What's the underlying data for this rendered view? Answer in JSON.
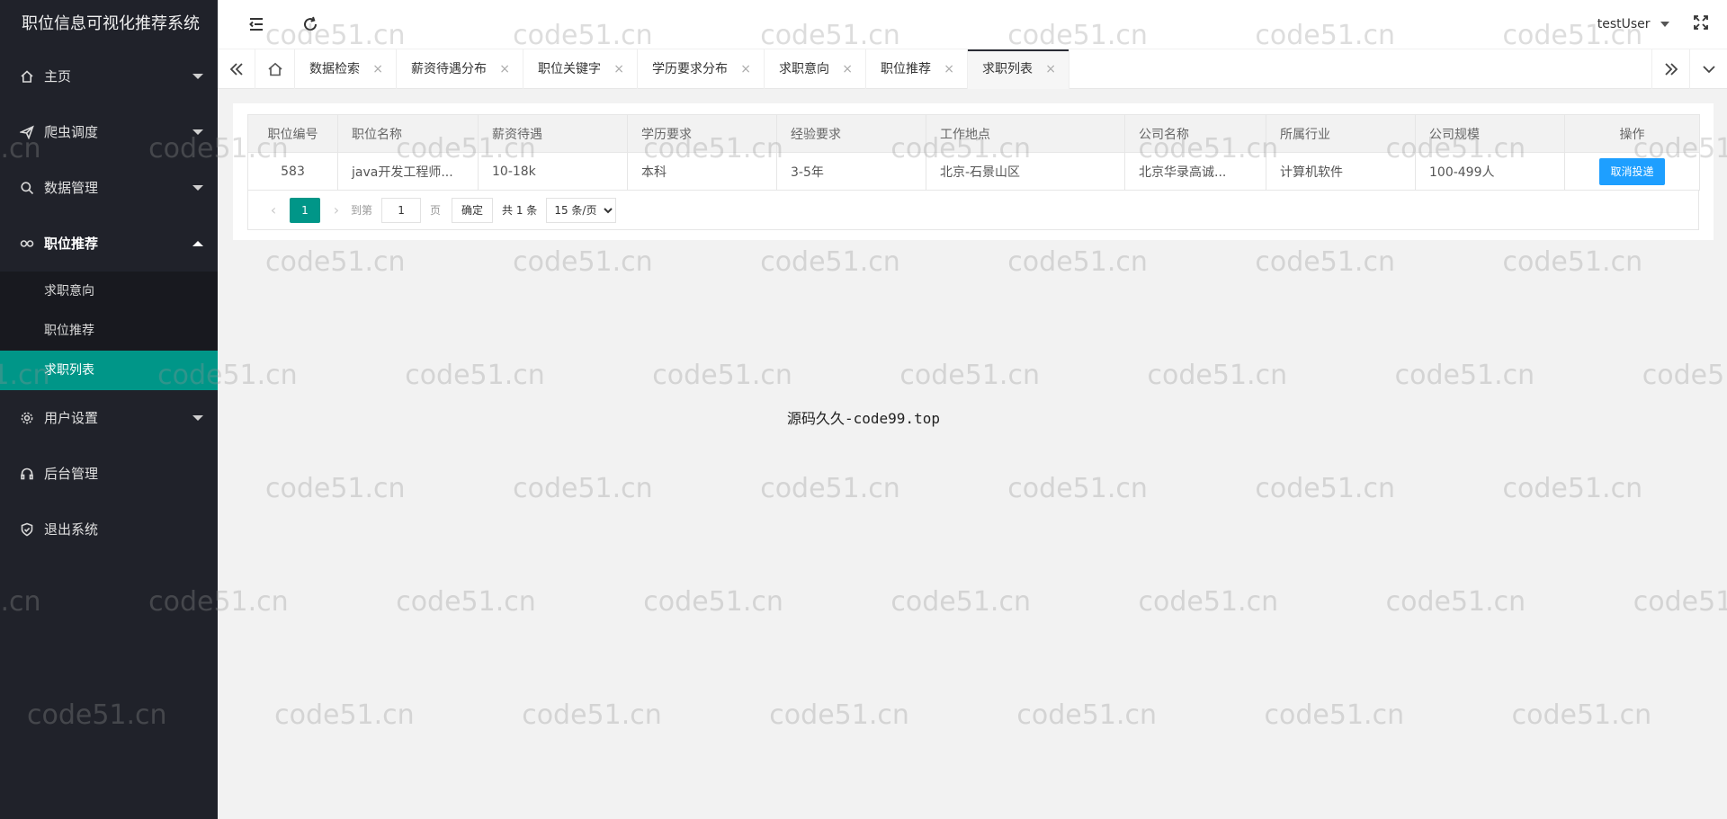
{
  "app": {
    "title": "职位信息可视化推荐系统"
  },
  "sidebar": {
    "items": [
      {
        "label": "主页",
        "icon": "home-icon",
        "hasSub": true
      },
      {
        "label": "爬虫调度",
        "icon": "send-icon",
        "hasSub": true
      },
      {
        "label": "数据管理",
        "icon": "search-icon",
        "hasSub": true
      },
      {
        "label": "职位推荐",
        "icon": "link-icon",
        "hasSub": true,
        "open": true
      },
      {
        "label": "用户设置",
        "icon": "gear-icon",
        "hasSub": true
      },
      {
        "label": "后台管理",
        "icon": "headset-icon",
        "hasSub": false
      },
      {
        "label": "退出系统",
        "icon": "shield-icon",
        "hasSub": false
      }
    ],
    "submenu": [
      {
        "label": "求职意向"
      },
      {
        "label": "职位推荐"
      },
      {
        "label": "求职列表",
        "active": true
      }
    ]
  },
  "header": {
    "user": "testUser"
  },
  "tabs": [
    {
      "label": "数据检索",
      "close": "×"
    },
    {
      "label": "薪资待遇分布",
      "close": "×"
    },
    {
      "label": "职位关键字",
      "close": "×"
    },
    {
      "label": "学历要求分布",
      "close": "×"
    },
    {
      "label": "求职意向",
      "close": "×"
    },
    {
      "label": "职位推荐",
      "close": "×"
    },
    {
      "label": "求职列表",
      "close": "×",
      "active": true
    }
  ],
  "table": {
    "columns": [
      "职位编号",
      "职位名称",
      "薪资待遇",
      "学历要求",
      "经验要求",
      "工作地点",
      "公司名称",
      "所属行业",
      "公司规模",
      "操作"
    ],
    "rows": [
      {
        "id": "583",
        "name": "java开发工程师...",
        "salary": "10-18k",
        "education": "本科",
        "experience": "3-5年",
        "location": "北京-石景山区",
        "company": "北京华录高诚...",
        "industry": "计算机软件",
        "scale": "100-499人",
        "action": "取消投递"
      }
    ]
  },
  "pager": {
    "prev": "‹",
    "next": "›",
    "current": "1",
    "goto_label": "到第",
    "page_value": "1",
    "page_label": "页",
    "confirm": "确定",
    "total": "共 1 条",
    "per_page": "15 条/页"
  },
  "source": "源码久久-code99.top",
  "watermark": "code51.cn"
}
